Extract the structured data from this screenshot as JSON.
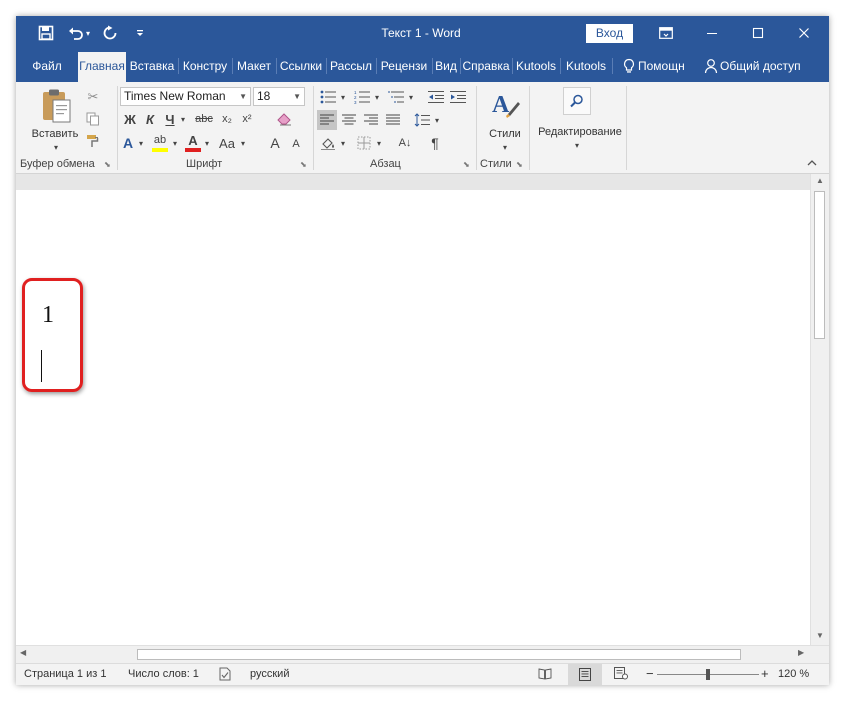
{
  "titlebar": {
    "document_title": "Текст 1  -  Word",
    "signin_label": "Вход",
    "icons": [
      "save-icon",
      "undo-icon",
      "redo-icon",
      "customize-qat-icon",
      "ribbon-display-icon",
      "minimize-icon",
      "maximize-icon",
      "close-icon"
    ]
  },
  "tabs": [
    {
      "label": "Файл"
    },
    {
      "label": "Главная"
    },
    {
      "label": "Вставка"
    },
    {
      "label": "Констру"
    },
    {
      "label": "Макет"
    },
    {
      "label": "Ссылки"
    },
    {
      "label": "Рассыл"
    },
    {
      "label": "Рецензи"
    },
    {
      "label": "Вид"
    },
    {
      "label": "Справка"
    },
    {
      "label": "Kutools"
    },
    {
      "label": "Kutools"
    },
    {
      "label": "Помощн"
    },
    {
      "label": "Общий доступ"
    }
  ],
  "ribbon": {
    "clipboard": {
      "paste_label": "Вставить",
      "group_label": "Буфер обмена"
    },
    "font": {
      "font_name": "Times New Roman",
      "font_size": "18",
      "bold": "Ж",
      "italic": "К",
      "underline": "Ч",
      "strike": "abc",
      "subscript": "x₂",
      "superscript": "x²",
      "effects": "A",
      "highlight": "ab",
      "color": "A",
      "case": "Aa",
      "grow": "A",
      "shrink": "A",
      "group_label": "Шрифт"
    },
    "paragraph": {
      "group_label": "Абзац",
      "sort": "A↓",
      "pilcrow": "¶"
    },
    "styles": {
      "styles_label": "Стили",
      "group_label": "Стили"
    },
    "editing": {
      "editing_label": "Редактирование"
    }
  },
  "document": {
    "text": "1"
  },
  "statusbar": {
    "page": "Страница 1 из 1",
    "words": "Число слов: 1",
    "language": "русский",
    "zoom": "120 %",
    "zoom_minus": "−",
    "zoom_plus": "+"
  },
  "colors": {
    "word_blue": "#2b579a",
    "highlight_red": "#e02020"
  }
}
